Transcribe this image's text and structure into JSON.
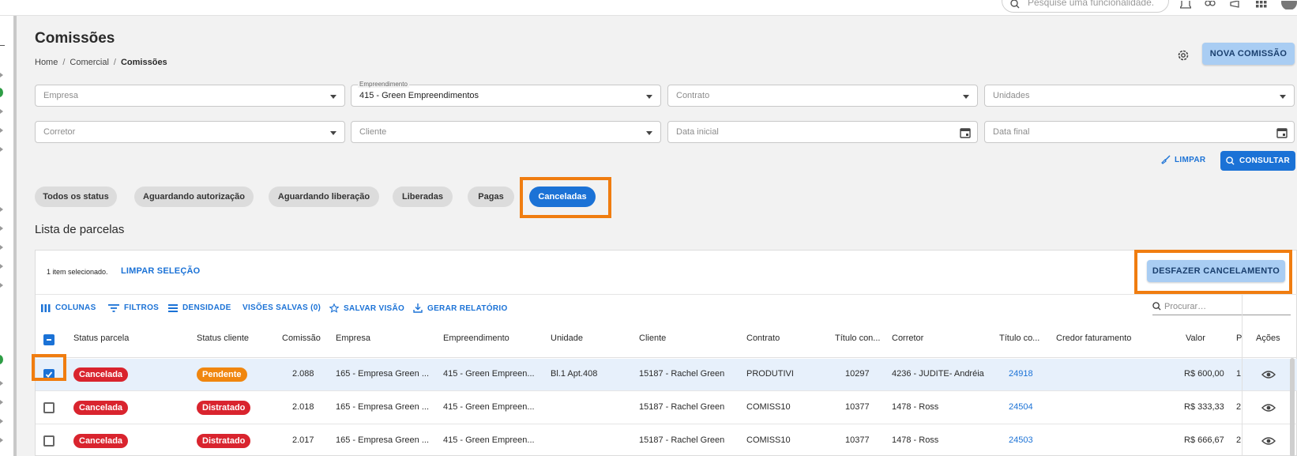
{
  "top": {
    "search_placeholder": "Pesquise uma funcionalidade."
  },
  "page": {
    "title": "Comissões",
    "breadcrumb": [
      "Home",
      "Comercial",
      "Comissões"
    ],
    "new_button": "NOVA COMISSÃO"
  },
  "filters": {
    "empresa": {
      "placeholder": "Empresa"
    },
    "empreendimento": {
      "label": "Empreendimento",
      "value": "415 - Green Empreendimentos"
    },
    "contrato": {
      "placeholder": "Contrato"
    },
    "unidades": {
      "placeholder": "Unidades"
    },
    "corretor": {
      "placeholder": "Corretor"
    },
    "cliente": {
      "placeholder": "Cliente"
    },
    "data_inicial": {
      "placeholder": "Data inicial"
    },
    "data_final": {
      "placeholder": "Data final"
    },
    "clear_label": "LIMPAR",
    "search_label": "CONSULTAR"
  },
  "status_chips": [
    {
      "label": "Todos os status",
      "active": false
    },
    {
      "label": "Aguardando autorização",
      "active": false
    },
    {
      "label": "Aguardando liberação",
      "active": false
    },
    {
      "label": "Liberadas",
      "active": false
    },
    {
      "label": "Pagas",
      "active": false
    },
    {
      "label": "Canceladas",
      "active": true
    }
  ],
  "list": {
    "title": "Lista de parcelas",
    "selection_info": "1 item selecionado.",
    "clear_selection": "LIMPAR SELEÇÃO",
    "undo_cancel_button": "DESFAZER CANCELAMENTO",
    "toolbar": {
      "columns": "COLUNAS",
      "filters": "FILTROS",
      "density": "DENSIDADE",
      "saved_views": "VISÕES SALVAS (0)",
      "save_view": "SALVAR VISÃO",
      "report": "GERAR RELATÓRIO",
      "search_placeholder": "Procurar…"
    },
    "columns": [
      "Status parcela",
      "Status cliente",
      "Comissão",
      "Empresa",
      "Empreendimento",
      "Unidade",
      "Cliente",
      "Contrato",
      "Título con...",
      "Corretor",
      "Título co...",
      "Credor faturamento",
      "Valor",
      "P",
      "Ações"
    ],
    "rows": [
      {
        "selected": true,
        "status_parcela": "Cancelada",
        "status_cliente": "Pendente",
        "status_cliente_color": "#f0860f",
        "comissao": "2.088",
        "empresa": "165 - Empresa Green ...",
        "empreendimento": "415 - Green Empreen...",
        "unidade": "Bl.1 Apt.408",
        "cliente": "15187 - Rachel Green",
        "contrato": "PRODUTIVI",
        "titulo_con": "10297",
        "corretor": "4236 - JUDITE- Andréia",
        "titulo_co": "24918",
        "credor": "",
        "valor": "R$ 600,00",
        "p": "1"
      },
      {
        "selected": false,
        "status_parcela": "Cancelada",
        "status_cliente": "Distratado",
        "status_cliente_color": "#d9242e",
        "comissao": "2.018",
        "empresa": "165 - Empresa Green ...",
        "empreendimento": "415 - Green Empreen...",
        "unidade": "",
        "cliente": "15187 - Rachel Green",
        "contrato": "COMISS10",
        "titulo_con": "10377",
        "corretor": "1478 - Ross",
        "titulo_co": "24504",
        "credor": "",
        "valor": "R$ 333,33",
        "p": "2"
      },
      {
        "selected": false,
        "status_parcela": "Cancelada",
        "status_cliente": "Distratado",
        "status_cliente_color": "#d9242e",
        "comissao": "2.017",
        "empresa": "165 - Empresa Green ...",
        "empreendimento": "415 - Green Empreen...",
        "unidade": "",
        "cliente": "15187 - Rachel Green",
        "contrato": "COMISS10",
        "titulo_con": "10377",
        "corretor": "1478 - Ross",
        "titulo_co": "24503",
        "credor": "",
        "valor": "R$ 666,67",
        "p": "2"
      }
    ]
  },
  "colors": {
    "primary": "#1b72d6",
    "primary_light": "#a9cdf3",
    "danger": "#d9242e",
    "warning": "#f0860f",
    "highlight": "#f07d10"
  }
}
